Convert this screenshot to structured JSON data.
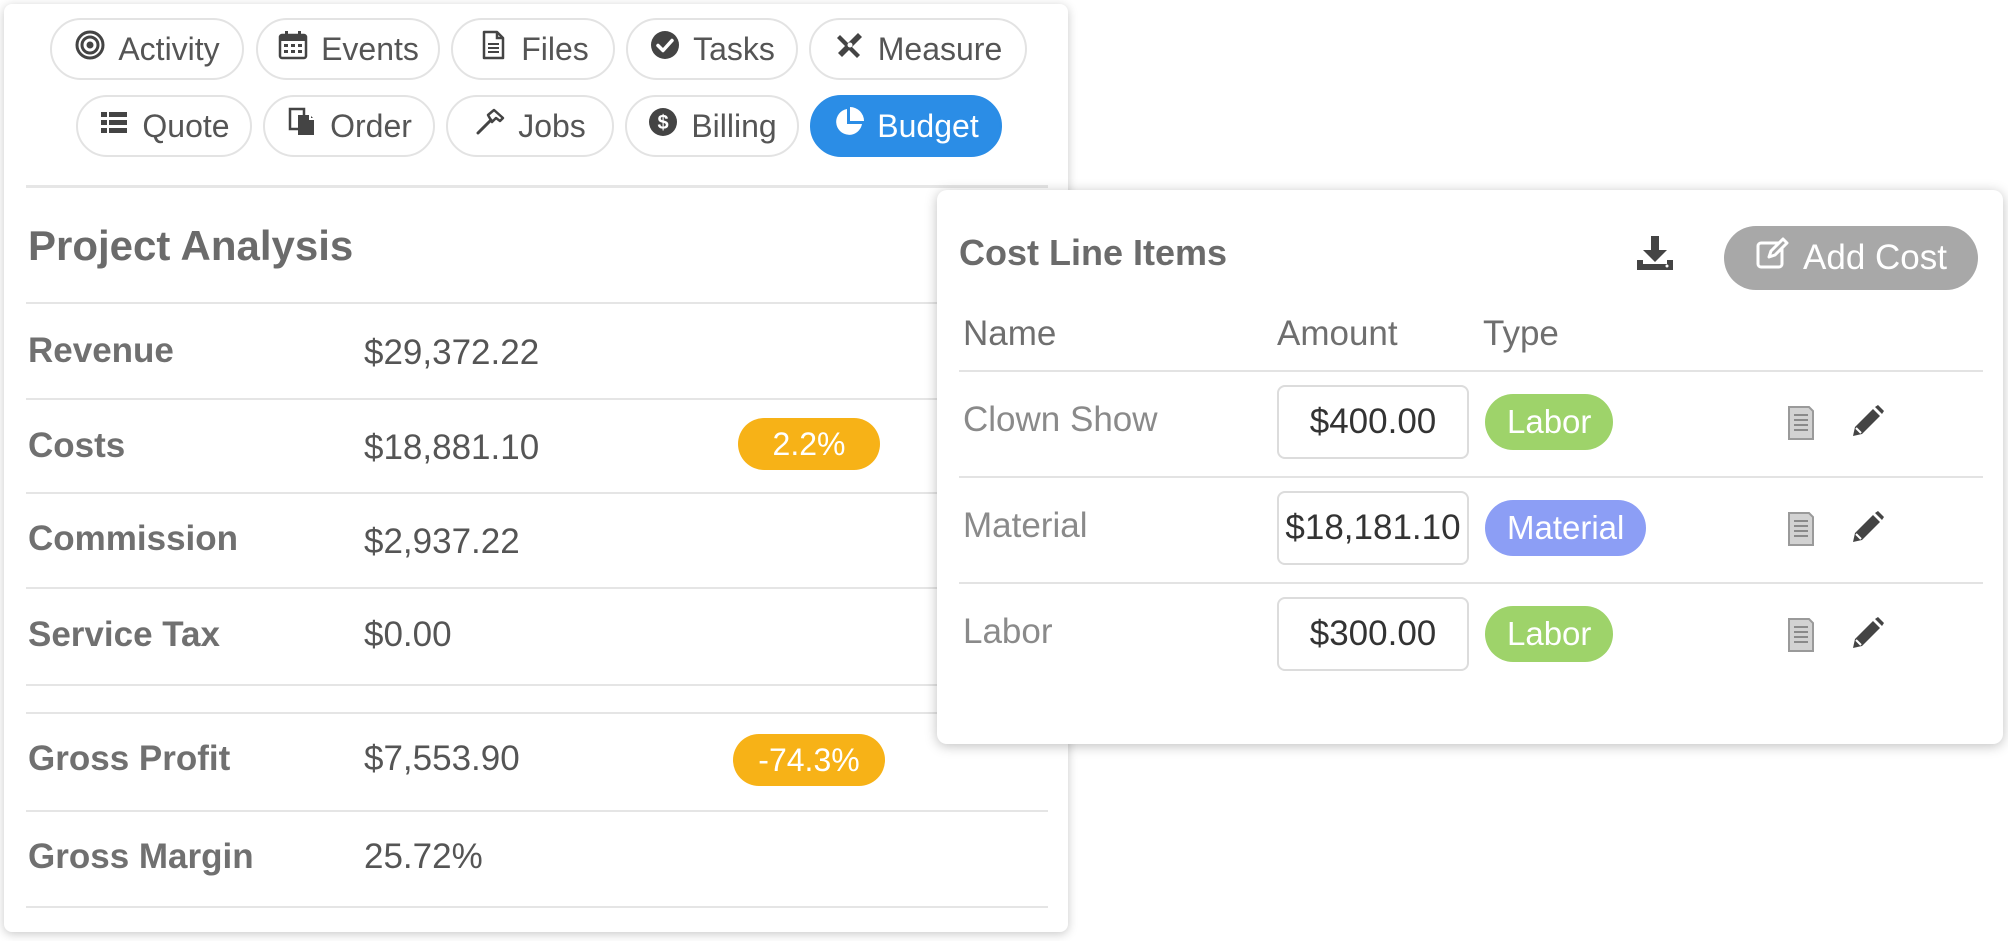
{
  "tabs_row1": [
    {
      "label": "Activity",
      "icon": "target-icon"
    },
    {
      "label": "Events",
      "icon": "calendar-icon"
    },
    {
      "label": "Files",
      "icon": "file-icon"
    },
    {
      "label": "Tasks",
      "icon": "check-circle-icon"
    },
    {
      "label": "Measure",
      "icon": "ruler-pencil-icon"
    }
  ],
  "tabs_row2": [
    {
      "label": "Quote",
      "icon": "list-icon"
    },
    {
      "label": "Order",
      "icon": "copy-icon"
    },
    {
      "label": "Jobs",
      "icon": "hammer-icon"
    },
    {
      "label": "Billing",
      "icon": "dollar-circle-icon"
    },
    {
      "label": "Budget",
      "icon": "pie-chart-icon",
      "active": true
    }
  ],
  "analysis": {
    "title": "Project Analysis",
    "rows": [
      {
        "label": "Revenue",
        "value": "$29,372.22"
      },
      {
        "label": "Costs",
        "value": "$18,881.10",
        "badge": "2.2%"
      },
      {
        "label": "Commission",
        "value": "$2,937.22"
      },
      {
        "label": "Service Tax",
        "value": "$0.00"
      },
      {
        "label": "Gross Profit",
        "value": "$7,553.90",
        "badge": "-74.3%"
      },
      {
        "label": "Gross Margin",
        "value": "25.72%"
      }
    ]
  },
  "cost_items": {
    "title": "Cost Line Items",
    "add_label": "Add Cost",
    "columns": [
      "Name",
      "Amount",
      "Type"
    ],
    "rows": [
      {
        "name": "Clown Show",
        "amount": "$400.00",
        "type": "Labor"
      },
      {
        "name": "Material",
        "amount": "$18,181.10",
        "type": "Material"
      },
      {
        "name": "Labor",
        "amount": "$300.00",
        "type": "Labor"
      }
    ]
  },
  "colors": {
    "active_tab": "#2b8de6",
    "badge_orange": "#f7b217",
    "labor": "#9ed36a",
    "material": "#8c9ef5",
    "add_button": "#a8a8a8"
  }
}
